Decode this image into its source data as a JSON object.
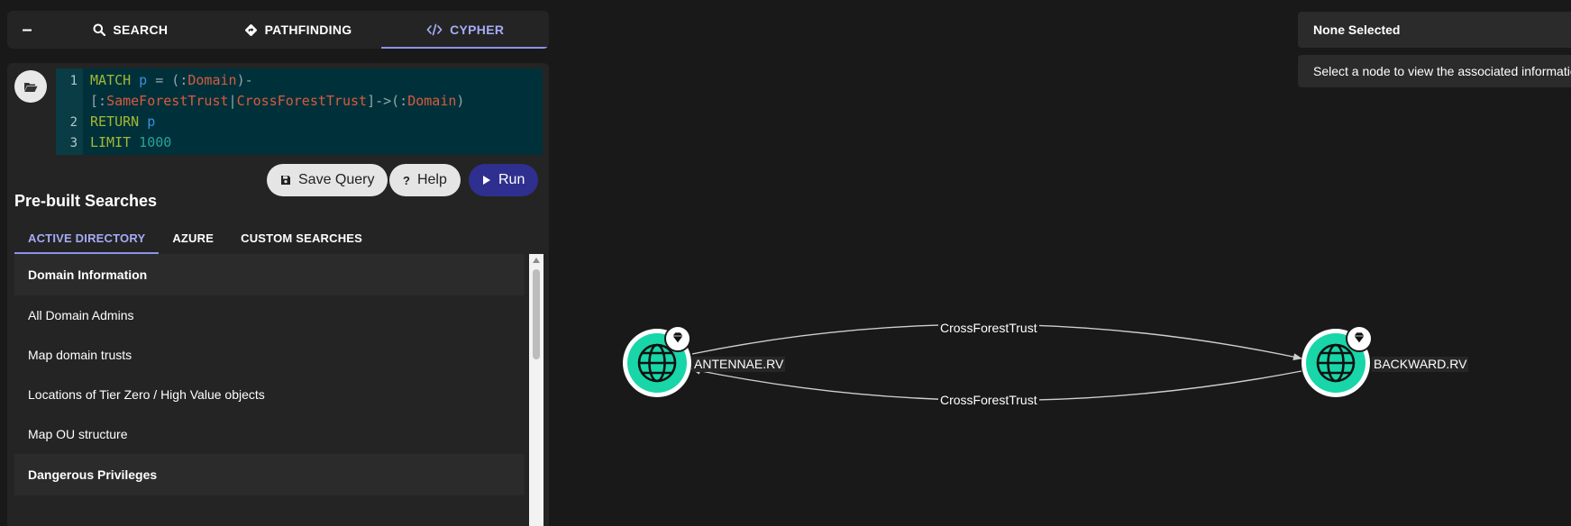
{
  "topnav": {
    "collapse": "–",
    "tabs": [
      {
        "label": "SEARCH",
        "icon": "search-icon"
      },
      {
        "label": "PATHFINDING",
        "icon": "diamond-directions-icon"
      },
      {
        "label": "CYPHER",
        "icon": "code-icon",
        "active": true
      }
    ]
  },
  "editor": {
    "lines": [
      {
        "num": "1",
        "parts": [
          "MATCH",
          " p ",
          "= (:",
          "Domain",
          ")-"
        ]
      },
      {
        "num": "",
        "parts": [
          "[:",
          "SameForestTrust",
          "|",
          "CrossForestTrust",
          "]->(:",
          "Domain",
          ")"
        ]
      },
      {
        "num": "2",
        "parts": [
          "RETURN",
          " p"
        ]
      },
      {
        "num": "3",
        "parts": [
          "LIMIT",
          " 1000"
        ]
      }
    ]
  },
  "buttons": {
    "save": "Save Query",
    "help": "Help",
    "run": "Run"
  },
  "prebuilt": {
    "title": "Pre-built Searches",
    "tabs": [
      "ACTIVE DIRECTORY",
      "AZURE",
      "CUSTOM SEARCHES"
    ],
    "header1": "Domain Information",
    "items": [
      "All Domain Admins",
      "Map domain trusts",
      "Locations of Tier Zero / High Value objects",
      "Map OU structure"
    ],
    "header2": "Dangerous Privileges"
  },
  "info": {
    "title": "None Selected",
    "message": "Select a node to view the associated information"
  },
  "graph": {
    "nodes": [
      {
        "label": "ANTENNAE.RV",
        "icon": "globe-icon",
        "badge": "gem-icon"
      },
      {
        "label": "BACKWARD.RV",
        "icon": "globe-icon",
        "badge": "gem-icon"
      }
    ],
    "edges": [
      {
        "label": "CrossForestTrust",
        "from": "ANTENNAE.RV",
        "to": "BACKWARD.RV"
      },
      {
        "label": "CrossForestTrust",
        "from": "BACKWARD.RV",
        "to": "ANTENNAE.RV"
      }
    ],
    "colors": {
      "node_fill": "#18d6a8",
      "background": "#191919",
      "accent": "#8c93e8",
      "run_button": "#2f2f8f"
    }
  }
}
